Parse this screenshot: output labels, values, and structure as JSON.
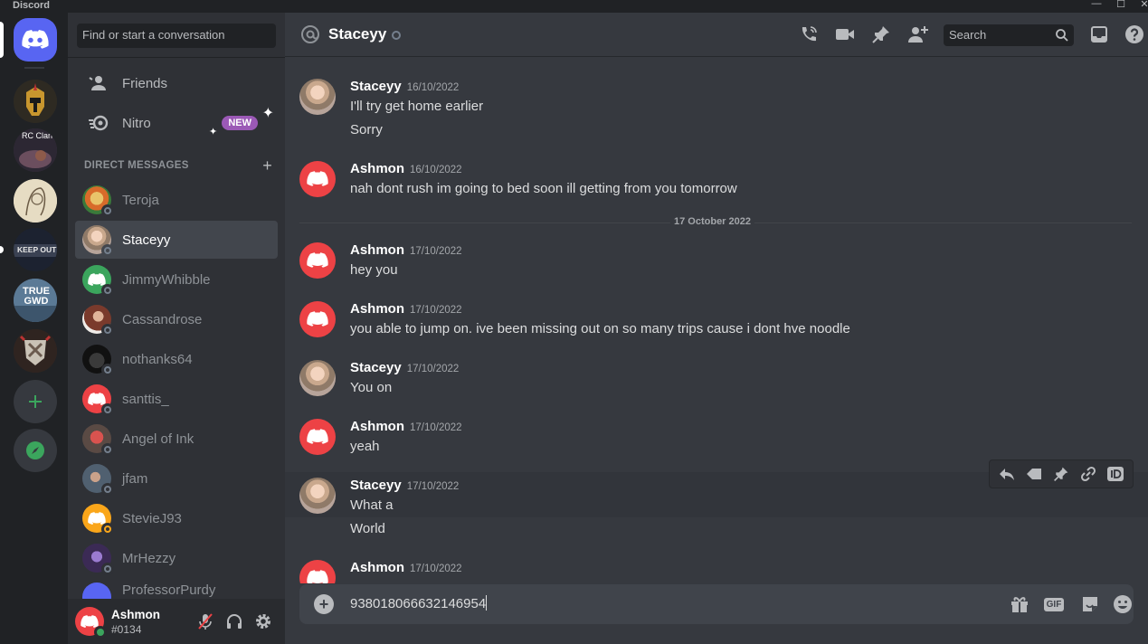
{
  "window": {
    "app_name": "Discord",
    "minimize": "—",
    "maximize": "☐",
    "close": "✕"
  },
  "rail": {
    "servers": [
      {
        "name": "home"
      },
      {
        "name": "helmet-server"
      },
      {
        "name": "rc-clan",
        "label": "RC Clan"
      },
      {
        "name": "sketch-server"
      },
      {
        "name": "keep-out",
        "label": "KEEP OUT"
      },
      {
        "name": "true-gwd",
        "label": "TRUE GWD"
      },
      {
        "name": "shield-server"
      }
    ]
  },
  "sidebar": {
    "search_placeholder": "Find or start a conversation",
    "friends_label": "Friends",
    "nitro_label": "Nitro",
    "nitro_badge": "NEW",
    "dm_header": "DIRECT MESSAGES",
    "dm_add": "+",
    "dms": [
      {
        "name": "Teroja",
        "color": "#c9a227"
      },
      {
        "name": "Staceyy",
        "color": "#c7a58c",
        "active": true
      },
      {
        "name": "JimmyWhibble",
        "color": "#3ba55d",
        "discord": true
      },
      {
        "name": "Cassandrose",
        "color": "#8a4b3c"
      },
      {
        "name": "nothanks64",
        "color": "#1d1d1d"
      },
      {
        "name": "santtis_",
        "color": "#ed4245",
        "discord": true
      },
      {
        "name": "Angel of Ink",
        "color": "#6b5b53"
      },
      {
        "name": "jfam",
        "color": "#4e5d6c"
      },
      {
        "name": "StevieJ93",
        "color": "#faa61a",
        "discord": true
      },
      {
        "name": "MrHezzy",
        "color": "#4b3a6b"
      },
      {
        "name": "ProfessorPurdy",
        "color": "#5865f2",
        "discord": true
      }
    ]
  },
  "user": {
    "name": "Ashmon",
    "tag": "#0134"
  },
  "header": {
    "title": "Staceyy",
    "search_placeholder": "Search"
  },
  "messages": [
    {
      "author": "Staceyy",
      "time": "16/10/2022",
      "lines": [
        "I'll try get home earlier",
        "Sorry"
      ]
    },
    {
      "author": "Ashmon",
      "time": "16/10/2022",
      "lines": [
        "nah dont rush im going to bed soon ill getting from you tomorrow"
      ]
    },
    {
      "author": "Ashmon",
      "time": "17/10/2022",
      "lines": [
        "hey you"
      ]
    },
    {
      "author": "Ashmon",
      "time": "17/10/2022",
      "lines": [
        "you able to jump on. ive been missing out on so many trips cause i dont hve noodle"
      ]
    },
    {
      "author": "Staceyy",
      "time": "17/10/2022",
      "lines": [
        "You on"
      ]
    },
    {
      "author": "Ashmon",
      "time": "17/10/2022",
      "lines": [
        "yeah"
      ]
    },
    {
      "author": "Staceyy",
      "time": "17/10/2022",
      "lines": [
        "What a",
        "World"
      ]
    },
    {
      "author": "Ashmon",
      "time": "17/10/2022",
      "lines": []
    }
  ],
  "date_divider": "17 October 2022",
  "composer": {
    "value": "938018066632146954",
    "gif_label": "GIF"
  }
}
